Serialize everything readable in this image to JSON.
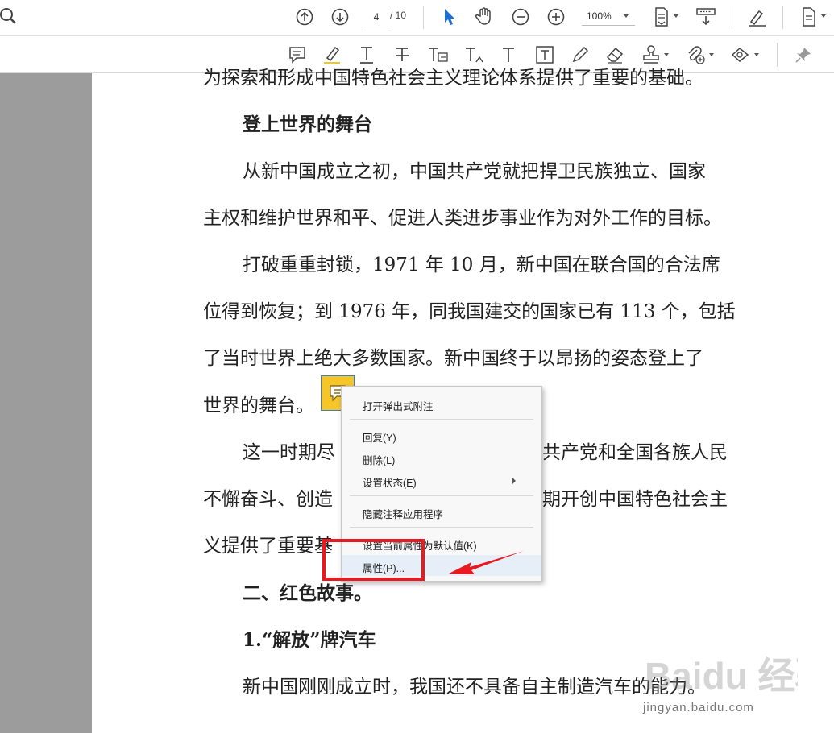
{
  "toolbar": {
    "page_current": "4",
    "page_total": "/ 10",
    "zoom": "100%"
  },
  "document": {
    "lines": [
      "为探索和形成中国特色社会主义理论体系提供了重要的基础。",
      "登上世界的舞台",
      "从新中国成立之初，中国共产党就把捍卫民族独立、国家",
      "主权和维护世界和平、促进人类进步事业作为对外工作的目标。",
      "打破重重封锁，1971 年 10 月，新中国在联合国的合法席",
      "位得到恢复；到 1976 年，同我国建交的国家已有 113 个，包括",
      "了当时世界上绝大多数国家。新中国终于以昂扬的姿态登上了",
      "世界的舞台。",
      "这一时期尽",
      "共产党和全国各族人民",
      "不懈奋斗、创造",
      "期开创中国特色社会主",
      "义提供了重要基",
      "二、红色故事。",
      "1.“解放”牌汽车",
      "新中国刚刚成立时，我国还不具备自主制造汽车的能力。"
    ]
  },
  "context_menu": {
    "items": [
      "打开弹出式附注",
      "回复(Y)",
      "删除(L)",
      "设置状态(E)",
      "隐藏注释应用程序",
      "设置当前属性为默认值(K)",
      "属性(P)..."
    ]
  },
  "watermark": {
    "text": "Baidu 经验",
    "url": "jingyan.baidu.com"
  },
  "colors": {
    "annotation_highlight": "#e8191f",
    "note_icon": "#f6c628",
    "selection": "#3b7fc9"
  }
}
